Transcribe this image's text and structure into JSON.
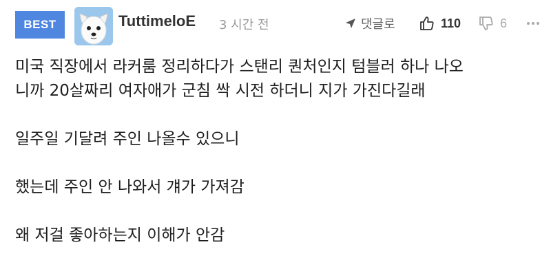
{
  "comment": {
    "badge": "BEST",
    "author": "TuttimeloE",
    "timestamp": "3 시간 전",
    "reply_label": "댓글로",
    "likes": "110",
    "dislikes": "6",
    "icons": {
      "avatar": "white-dog-avatar",
      "reply": "reply-arrow-icon",
      "like": "thumbs-up-icon",
      "dislike": "thumbs-down-icon",
      "more": "more-dots-icon"
    },
    "colors": {
      "badge_bg": "#4f86e0",
      "meta_text": "#9a9a9a"
    },
    "paragraphs": [
      [
        "미국 직장에서 라커룸 정리하다가 스탠리 퀀처인지 텀블러 하나 나오",
        "니까 20살짜리 여자애가 군침 싹 시전 하더니 지가 가진다길래"
      ],
      [
        "일주일 기달려 주인 나올수 있으니"
      ],
      [
        "했는데 주인 안 나와서 걔가 가져감"
      ],
      [
        "왜 저걸 좋아하는지 이해가 안감"
      ]
    ]
  }
}
